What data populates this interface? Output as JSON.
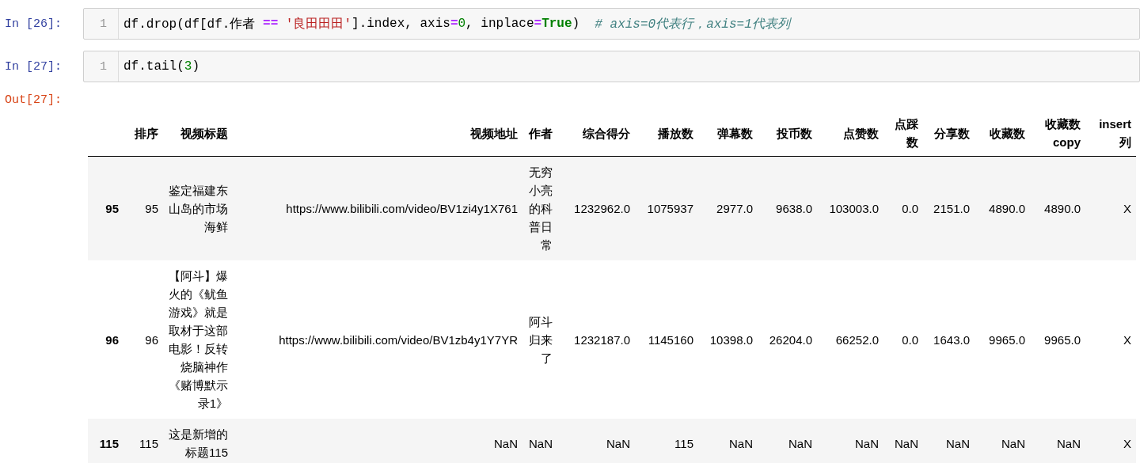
{
  "cells": [
    {
      "prompt": "In [26]:",
      "line_numbers": [
        "1"
      ],
      "code": [
        {
          "kind": "plain",
          "text": "df.drop(df[df.作者 "
        },
        {
          "kind": "op",
          "text": "== "
        },
        {
          "kind": "string",
          "text": "'良田田田'"
        },
        {
          "kind": "plain",
          "text": "].index, axis"
        },
        {
          "kind": "op",
          "text": "="
        },
        {
          "kind": "number",
          "text": "0"
        },
        {
          "kind": "plain",
          "text": ", inplace"
        },
        {
          "kind": "op",
          "text": "="
        },
        {
          "kind": "keyword",
          "text": "True"
        },
        {
          "kind": "plain",
          "text": ")  "
        },
        {
          "kind": "comment",
          "text": "# axis=0代表行，axis=1代表列"
        }
      ]
    },
    {
      "prompt": "In [27]:",
      "line_numbers": [
        "1"
      ],
      "code": [
        {
          "kind": "plain",
          "text": "df.tail("
        },
        {
          "kind": "number",
          "text": "3"
        },
        {
          "kind": "plain",
          "text": ")"
        }
      ]
    }
  ],
  "output": {
    "prompt": "Out[27]:",
    "table": {
      "columns": [
        "排序",
        "视频标题",
        "视频地址",
        "作者",
        "综合得分",
        "播放数",
        "弹幕数",
        "投币数",
        "点赞数",
        "点踩数",
        "分享数",
        "收藏数",
        "收藏数copy",
        "insert列"
      ],
      "rows": [
        {
          "index": "95",
          "values": [
            "95",
            "鉴定福建东山岛的市场海鲜",
            "https://www.bilibili.com/video/BV1zi4y1X761",
            "无穷小亮的科普日常",
            "1232962.0",
            "1075937",
            "2977.0",
            "9638.0",
            "103003.0",
            "0.0",
            "2151.0",
            "4890.0",
            "4890.0",
            "X"
          ]
        },
        {
          "index": "96",
          "values": [
            "96",
            "【阿斗】爆火的《鱿鱼游戏》就是取材于这部电影！反转烧脑神作《赌博默示录1》",
            "https://www.bilibili.com/video/BV1zb4y1Y7YR",
            "阿斗归来了",
            "1232187.0",
            "1145160",
            "10398.0",
            "26204.0",
            "66252.0",
            "0.0",
            "1643.0",
            "9965.0",
            "9965.0",
            "X"
          ]
        },
        {
          "index": "115",
          "values": [
            "115",
            "这是新增的标题115",
            "NaN",
            "NaN",
            "NaN",
            "115",
            "NaN",
            "NaN",
            "NaN",
            "NaN",
            "NaN",
            "NaN",
            "NaN",
            "X"
          ]
        }
      ]
    }
  }
}
